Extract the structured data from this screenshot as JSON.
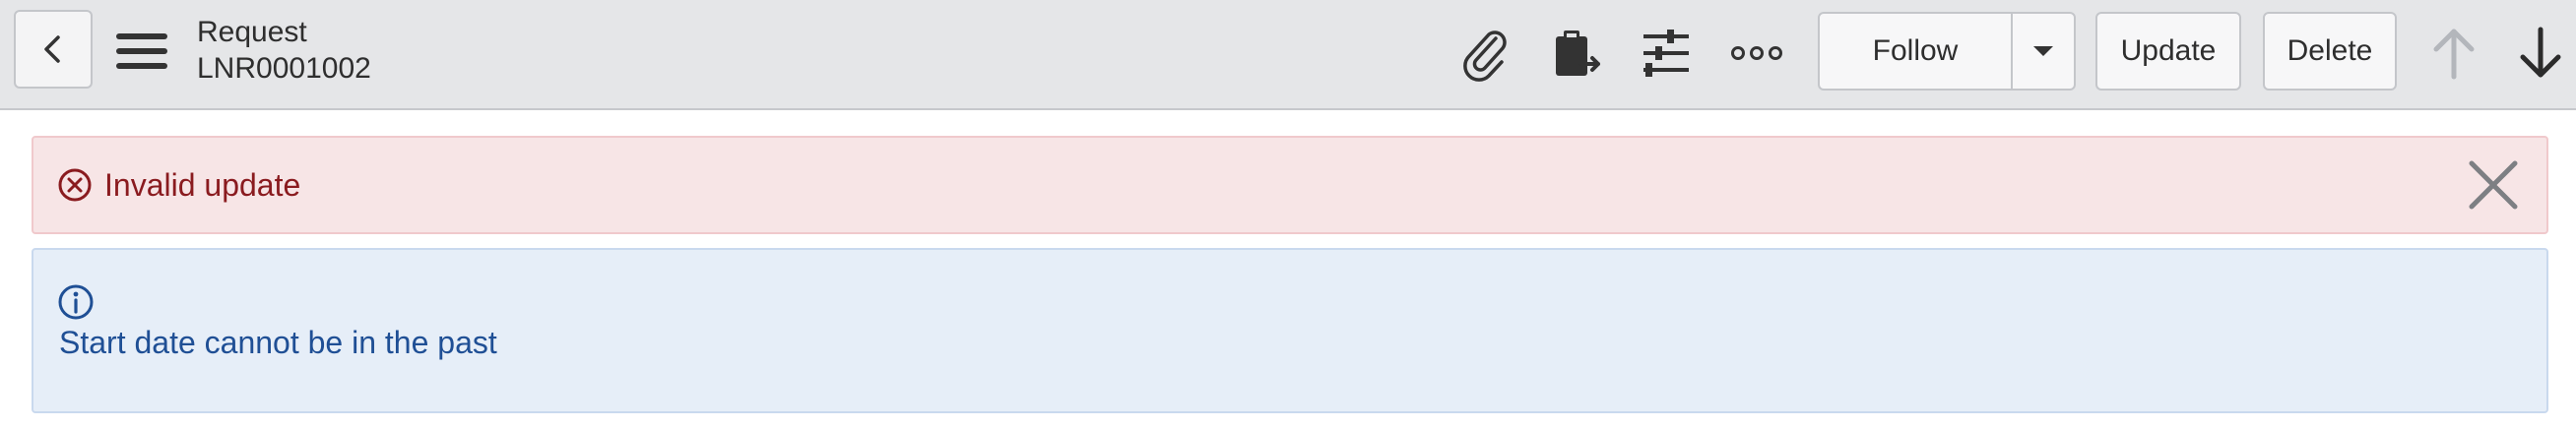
{
  "header": {
    "title": "Request",
    "number": "LNR0001002"
  },
  "toolbar": {
    "icons": [
      "paperclip-icon",
      "clipboard-export-icon",
      "sliders-icon",
      "more-icon"
    ],
    "follow_label": "Follow",
    "update_label": "Update",
    "delete_label": "Delete"
  },
  "alerts": {
    "error_text": "Invalid update",
    "info_text": "Start date cannot be in the past"
  },
  "colors": {
    "header_bg": "#e5e6e8",
    "error_bg": "#f7e5e6",
    "error_text": "#8a1b1f",
    "info_bg": "#e6eef8",
    "info_text": "#1f4f95"
  }
}
